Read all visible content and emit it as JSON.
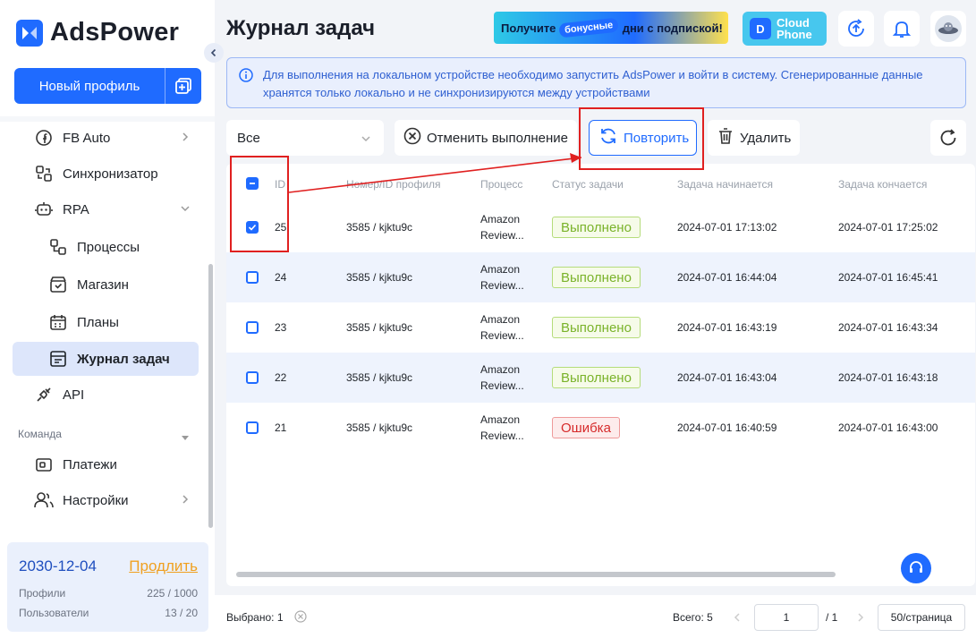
{
  "app": {
    "brand": "AdsPower"
  },
  "sidebar": {
    "new_profile_label": "Новый профиль",
    "items": [
      {
        "label": "FB Auto",
        "icon": "facebook-icon"
      },
      {
        "label": "Синхронизатор",
        "icon": "synchronizer-icon"
      },
      {
        "label": "RPA",
        "icon": "robot-icon"
      },
      {
        "label": "Процессы",
        "icon": "process-icon"
      },
      {
        "label": "Магазин",
        "icon": "store-icon"
      },
      {
        "label": "Планы",
        "icon": "calendar-icon"
      },
      {
        "label": "Журнал задач",
        "icon": "task-log-icon",
        "active": true
      },
      {
        "label": "API",
        "icon": "api-icon"
      }
    ],
    "team_section": "Команда",
    "team_items": [
      {
        "label": "Платежи",
        "icon": "wallet-icon"
      },
      {
        "label": "Настройки",
        "icon": "users-settings-icon"
      }
    ]
  },
  "plan": {
    "expiry_date": "2030-12-04",
    "extend_label": "Продлить",
    "profiles_label": "Профили",
    "profiles_value": "225 / 1000",
    "users_label": "Пользователи",
    "users_value": "13 / 20"
  },
  "header": {
    "title": "Журнал задач",
    "banner_part1": "Получите",
    "banner_pill": "бонусные",
    "banner_part2": "дни с подпиской!",
    "cloud_phone_line1": "Cloud",
    "cloud_phone_line2": "Phone"
  },
  "info": {
    "text": "Для выполнения на локальном устройстве необходимо запустить AdsPower и войти в систему. Сгенерированные данные хранятся только локально и не синхронизируются между устройствами"
  },
  "toolbar": {
    "filter_value": "Все",
    "cancel_label": "Отменить выполнение",
    "retry_label": "Повторить",
    "delete_label": "Удалить"
  },
  "table": {
    "headers": {
      "id": "ID",
      "profile": "Номер/ID профиля",
      "process": "Процесс",
      "status": "Статус задачи",
      "start": "Задача начинается",
      "end": "Задача кончается"
    },
    "rows": [
      {
        "id": "25",
        "profile": "3585 / kjktu9c",
        "process_line1": "Amazon",
        "process_line2": "Review...",
        "status": "Выполнено",
        "status_type": "ok",
        "start": "2024-07-01 17:13:02",
        "end": "2024-07-01 17:25:02",
        "checked": true
      },
      {
        "id": "24",
        "profile": "3585 / kjktu9c",
        "process_line1": "Amazon",
        "process_line2": "Review...",
        "status": "Выполнено",
        "status_type": "ok",
        "start": "2024-07-01 16:44:04",
        "end": "2024-07-01 16:45:41",
        "checked": false
      },
      {
        "id": "23",
        "profile": "3585 / kjktu9c",
        "process_line1": "Amazon",
        "process_line2": "Review...",
        "status": "Выполнено",
        "status_type": "ok",
        "start": "2024-07-01 16:43:19",
        "end": "2024-07-01 16:43:34",
        "checked": false
      },
      {
        "id": "22",
        "profile": "3585 / kjktu9c",
        "process_line1": "Amazon",
        "process_line2": "Review...",
        "status": "Выполнено",
        "status_type": "ok",
        "start": "2024-07-01 16:43:04",
        "end": "2024-07-01 16:43:18",
        "checked": false
      },
      {
        "id": "21",
        "profile": "3585 / kjktu9c",
        "process_line1": "Amazon",
        "process_line2": "Review...",
        "status": "Ошибка",
        "status_type": "err",
        "start": "2024-07-01 16:40:59",
        "end": "2024-07-01 16:43:00",
        "checked": false
      }
    ]
  },
  "footer": {
    "selected_label": "Выбрано: 1",
    "total_label": "Всего: 5",
    "current_page": "1",
    "total_pages": "/ 1",
    "per_page": "50/страница"
  },
  "colors": {
    "accent": "#1f6bff",
    "success": "#7ab32a",
    "error": "#d62b2b",
    "annotation": "#e02020"
  }
}
